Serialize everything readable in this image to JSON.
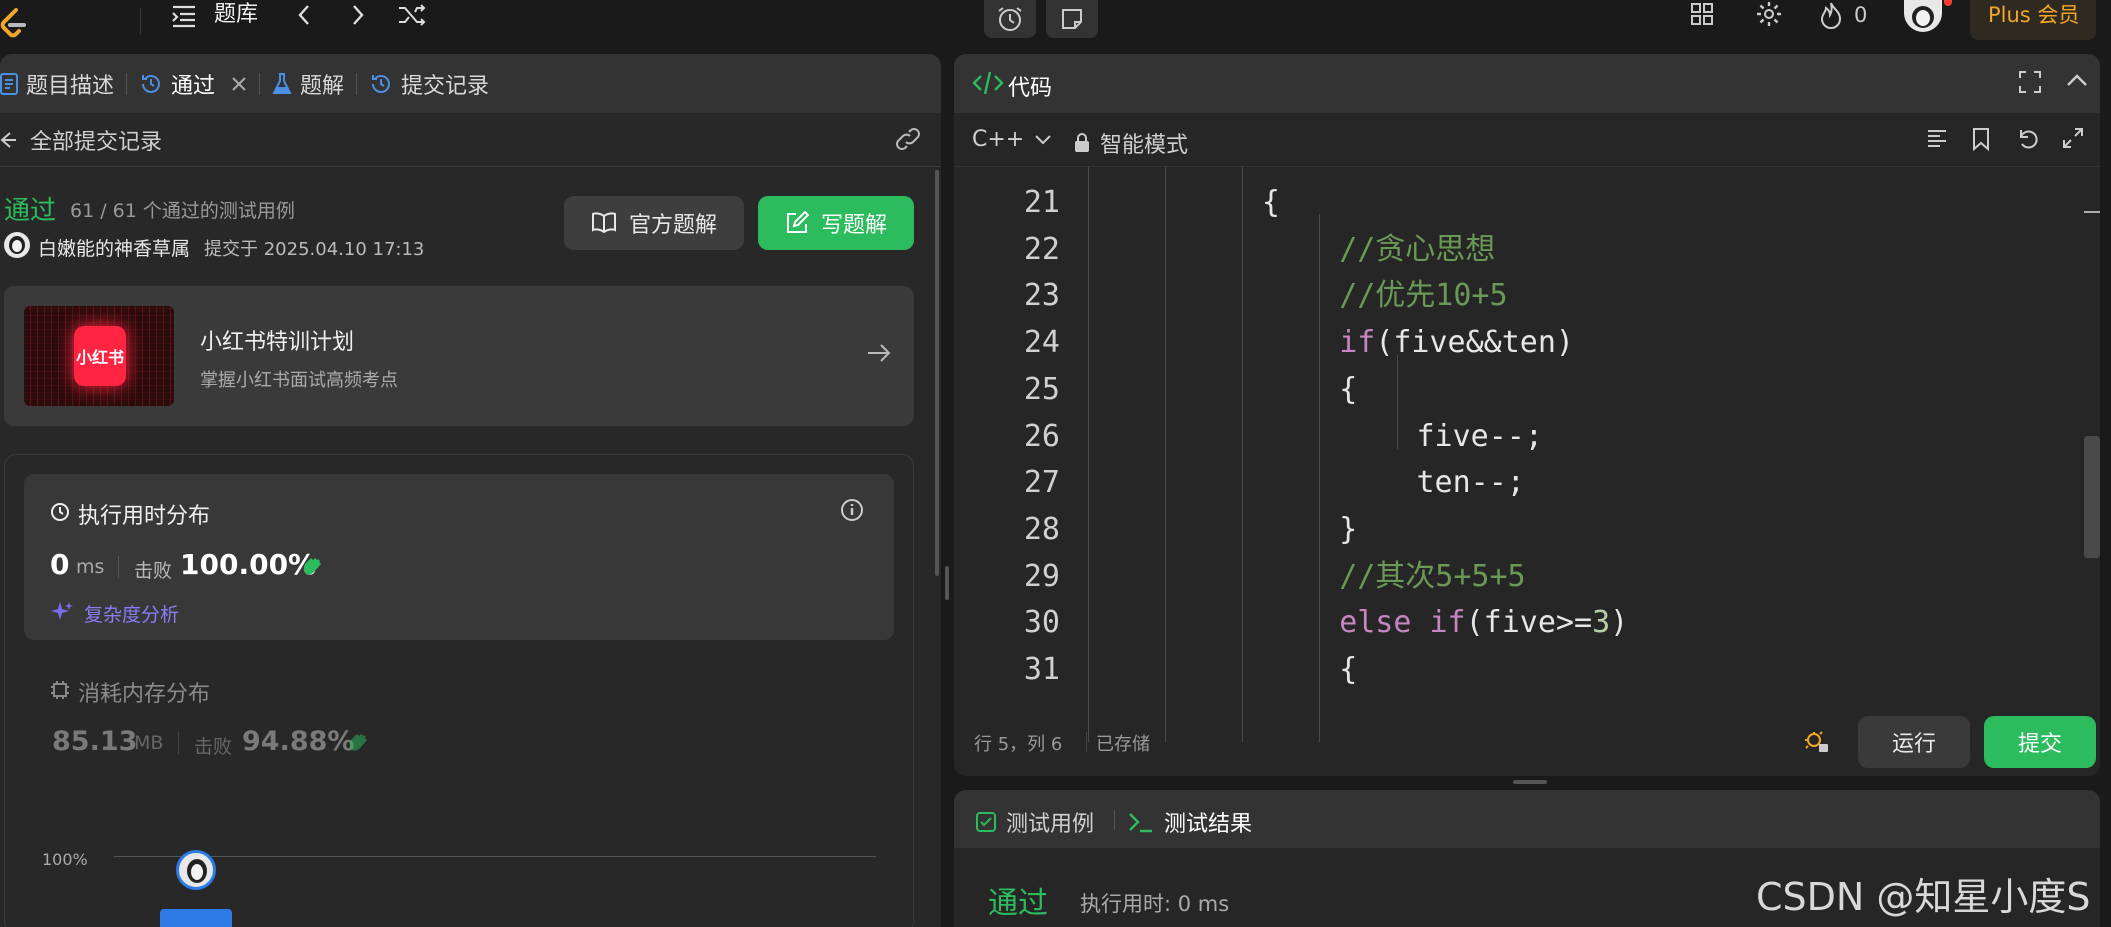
{
  "topbar": {
    "problem_bank": "题库",
    "streak_count": "0",
    "plus_label": "Plus 会员"
  },
  "left": {
    "tabs": {
      "description": "题目描述",
      "accepted": "通过",
      "solutions": "题解",
      "submissions": "提交记录"
    },
    "all_submissions": "全部提交记录",
    "status": "通过",
    "testcases": "61 / 61 个通过的测试用例",
    "username": "白嫩能的神香草属",
    "submitted_at": "提交于 2025.04.10 17:13",
    "official_solution_btn": "官方题解",
    "write_solution_btn": "写题解",
    "promo": {
      "logo_text": "小红书",
      "title": "小红书特训计划",
      "subtitle": "掌握小红书面试高频考点"
    },
    "runtime": {
      "title": "执行用时分布",
      "value": "0",
      "unit": "ms",
      "beats_label": "击败",
      "beats_value": "100.00%",
      "complexity_link": "复杂度分析"
    },
    "memory": {
      "title": "消耗内存分布",
      "value": "85.13",
      "unit": "MB",
      "beats_label": "击败",
      "beats_value": "94.88%"
    },
    "chart": {
      "y_label": "100%"
    }
  },
  "editor": {
    "title": "代码",
    "language": "C++",
    "mode": "智能模式",
    "status_position": "行 5，列 6",
    "status_saved": "已存储",
    "run_btn": "运行",
    "submit_btn": "提交",
    "lines": [
      {
        "num": "21",
        "indent": 3,
        "tokens": [
          {
            "t": "{",
            "c": "plain"
          }
        ]
      },
      {
        "num": "22",
        "indent": 4,
        "tokens": [
          {
            "t": "//贪心思想",
            "c": "comment"
          }
        ]
      },
      {
        "num": "23",
        "indent": 4,
        "tokens": [
          {
            "t": "//优先10+5",
            "c": "comment"
          }
        ]
      },
      {
        "num": "24",
        "indent": 4,
        "tokens": [
          {
            "t": "if",
            "c": "kw"
          },
          {
            "t": "(five&&ten)",
            "c": "plain"
          }
        ]
      },
      {
        "num": "25",
        "indent": 4,
        "tokens": [
          {
            "t": "{",
            "c": "plain"
          }
        ]
      },
      {
        "num": "26",
        "indent": 5,
        "tokens": [
          {
            "t": "five--;",
            "c": "plain"
          }
        ]
      },
      {
        "num": "27",
        "indent": 5,
        "tokens": [
          {
            "t": "ten--;",
            "c": "plain"
          }
        ]
      },
      {
        "num": "28",
        "indent": 4,
        "tokens": [
          {
            "t": "}",
            "c": "plain"
          }
        ]
      },
      {
        "num": "29",
        "indent": 4,
        "tokens": [
          {
            "t": "//其次5+5+5",
            "c": "comment"
          }
        ]
      },
      {
        "num": "30",
        "indent": 4,
        "tokens": [
          {
            "t": "else",
            "c": "kw"
          },
          {
            "t": " ",
            "c": "plain"
          },
          {
            "t": "if",
            "c": "kw"
          },
          {
            "t": "(five>=",
            "c": "plain"
          },
          {
            "t": "3",
            "c": "num"
          },
          {
            "t": ")",
            "c": "plain"
          }
        ]
      },
      {
        "num": "31",
        "indent": 4,
        "tokens": [
          {
            "t": "{",
            "c": "plain"
          }
        ]
      }
    ]
  },
  "bottom": {
    "tab_testcase": "测试用例",
    "tab_result": "测试结果",
    "status": "通过",
    "runtime": "执行用时: 0 ms"
  },
  "watermark": "CSDN @知星小度S",
  "colors": {
    "accent_green": "#2cbb5d",
    "comment_green": "#6a9955",
    "keyword_purple": "#c586c0",
    "number_green": "#b5cea8",
    "link_purple": "#8b7cf6",
    "plus_orange": "#f5a623"
  }
}
